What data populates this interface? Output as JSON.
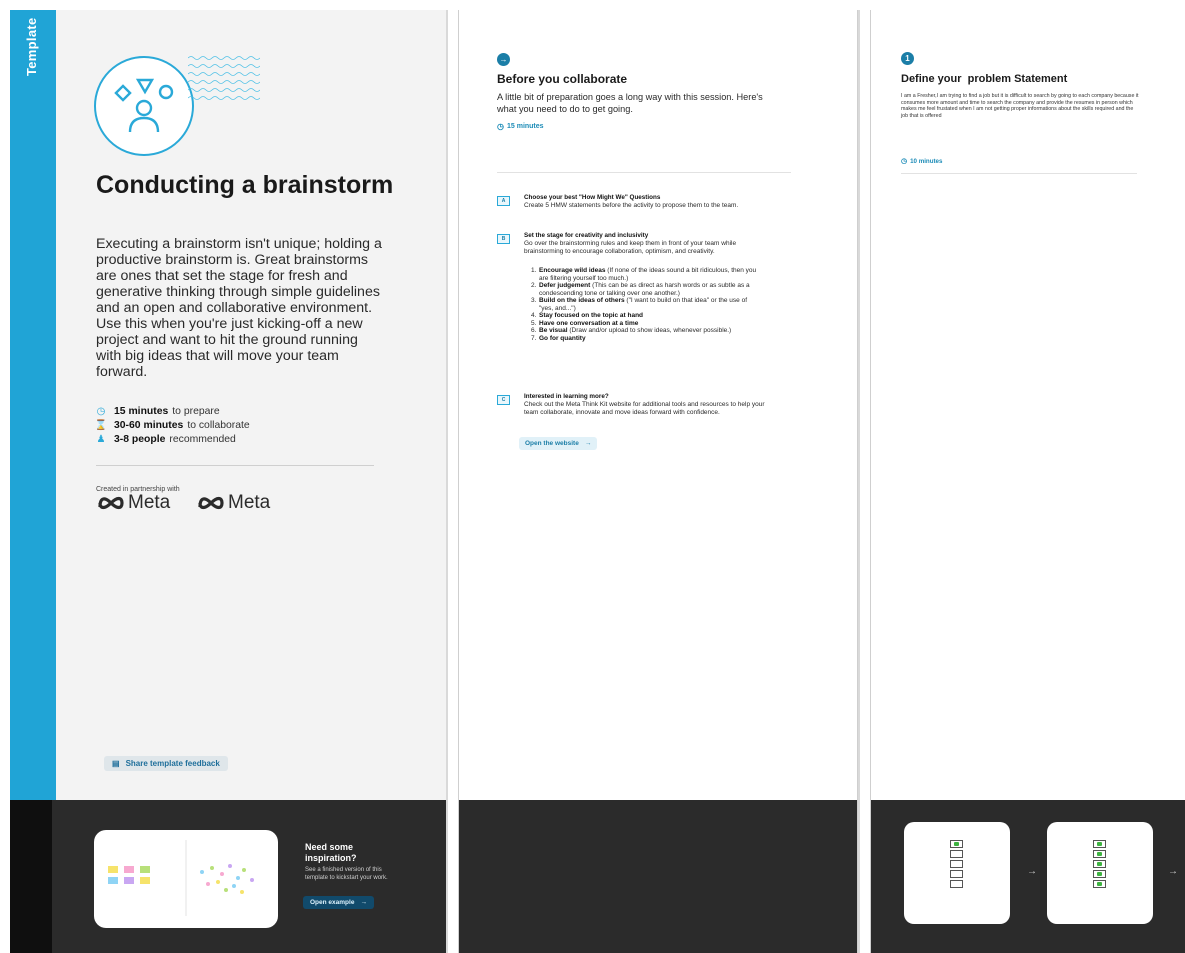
{
  "panel1": {
    "side_label": "Template",
    "title": "Conducting a brainstorm",
    "description": "Executing a brainstorm isn't unique; holding a productive brainstorm is. Great brainstorms are ones that set the stage for fresh and generative thinking through simple guidelines and an open and collaborative environment. Use this when you're just kicking-off a new project and want to hit the ground running with big ideas that will move your team forward.",
    "meta": [
      {
        "icon": "clock-icon",
        "bold": "15 minutes",
        "text": "to prepare"
      },
      {
        "icon": "hourglass-icon",
        "bold": "30-60 minutes",
        "text": "to collaborate"
      },
      {
        "icon": "person-icon",
        "bold": "3-8 people",
        "text": "recommended"
      }
    ],
    "partner_label": "Created in partnership with",
    "partner_logo_1": "Meta",
    "partner_logo_2": "Meta",
    "feedback_button": "Share template feedback",
    "inspiration_title": "Need some inspiration?",
    "inspiration_desc": "See a finished version of this template to kickstart your work.",
    "open_example": "Open example",
    "arrow": "→",
    "brand_color": "#20a4d6"
  },
  "panel2": {
    "step_icon": "→",
    "title": "Before you collaborate",
    "intro": "A little bit of preparation goes a long way with this session. Here's what you need to do to get going.",
    "time": "15 minutes",
    "steps": [
      {
        "badge": "A",
        "title": "Choose your best \"How Might We\" Questions",
        "body": "Create 5 HMW statements before the activity to propose them to the team."
      },
      {
        "badge": "B",
        "title": "Set the stage for creativity and inclusivity",
        "body": "Go over the brainstorming rules and keep them in front of your team while brainstorming to encourage collaboration, optimism, and creativity."
      },
      {
        "badge": "C",
        "title": "Interested in learning more?",
        "body": "Check out the Meta Think Kit website for additional tools and resources to help your team collaborate, innovate and move ideas forward with confidence."
      }
    ],
    "rules": [
      {
        "n": "1.",
        "bold": "Encourage wild ideas",
        "text": " (If none of the ideas sound a bit ridiculous, then you are filtering yourself too much.)"
      },
      {
        "n": "2.",
        "bold": "Defer judgement",
        "text": " (This can be as direct as harsh words or as subtle as a condescending tone or talking over one another.)"
      },
      {
        "n": "3.",
        "bold": "Build on the ideas of others",
        "text": " (\"I want to build on that idea\" or the use of \"yes, and...\")"
      },
      {
        "n": "4.",
        "bold": "Stay focused on the topic at hand",
        "text": ""
      },
      {
        "n": "5.",
        "bold": "Have one conversation at a time",
        "text": ""
      },
      {
        "n": "6.",
        "bold": "Be visual",
        "text": " (Draw and/or upload to show ideas, whenever possible.)"
      },
      {
        "n": "7.",
        "bold": "Go for quantity",
        "text": ""
      }
    ],
    "open_website": "Open the website",
    "arrow": "→"
  },
  "panel3": {
    "step_number": "1",
    "title": "Define your  problem Statement",
    "body": "I am a Fresher,I am trying to find a job but it is difficult to search by going to each company because it consumes more amount and time to search the company and provide the resumes in person which makes me feel frustated when I am not getting proper informations about the skills required and the job that is offered",
    "time": "10 minutes",
    "card1_checks": [
      true,
      false,
      false,
      false,
      false
    ],
    "card2_checks": [
      true,
      true,
      true,
      true,
      true
    ],
    "arrow": "→"
  }
}
